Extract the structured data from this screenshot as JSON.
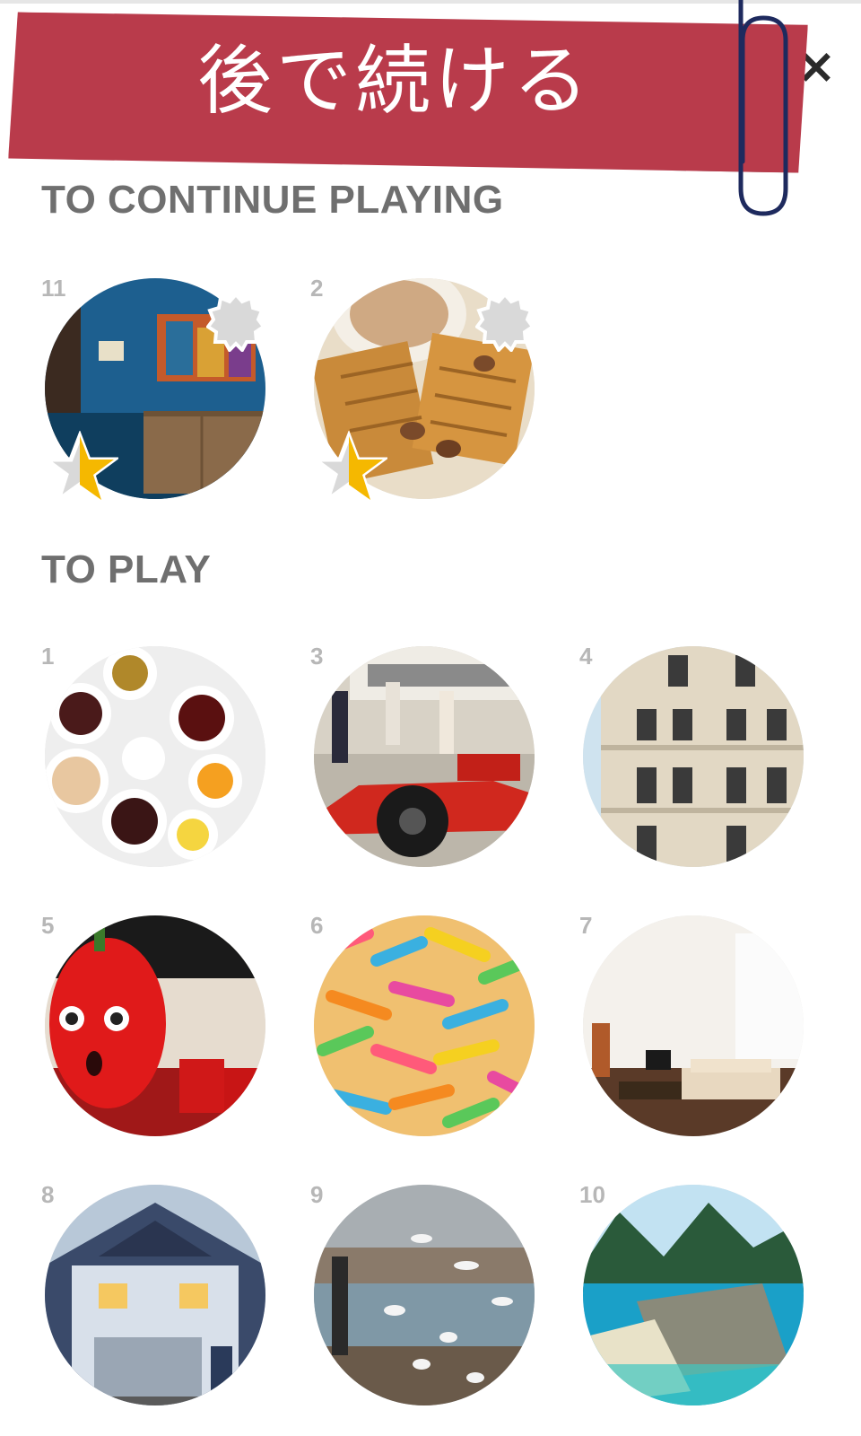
{
  "banner": {
    "text": "後で続ける"
  },
  "sections": {
    "continue_title": "TO CONTINUE PLAYING",
    "play_title": "TO PLAY"
  },
  "continue_levels": [
    {
      "number": "11",
      "theme": "blue-living-room",
      "star_fraction": 0.5,
      "seal_icon": "seal-icon"
    },
    {
      "number": "2",
      "theme": "waffles",
      "star_fraction": 0.5,
      "seal_icon": "seal-icon"
    }
  ],
  "play_levels": [
    {
      "number": "1",
      "theme": "tea-cups"
    },
    {
      "number": "3",
      "theme": "race-car"
    },
    {
      "number": "4",
      "theme": "building"
    },
    {
      "number": "5",
      "theme": "red-pepper-face"
    },
    {
      "number": "6",
      "theme": "gummy-worms"
    },
    {
      "number": "7",
      "theme": "white-living-room"
    },
    {
      "number": "8",
      "theme": "house"
    },
    {
      "number": "9",
      "theme": "birds-harbor"
    },
    {
      "number": "10",
      "theme": "tropical-island"
    }
  ],
  "colors": {
    "banner": "#b93b4b",
    "section_title": "#6f6f6f",
    "level_number": "#b7b7b7",
    "star_fill": "#f5b800",
    "star_empty": "#d9d9d9",
    "clip_stroke": "#1e2a5e"
  }
}
